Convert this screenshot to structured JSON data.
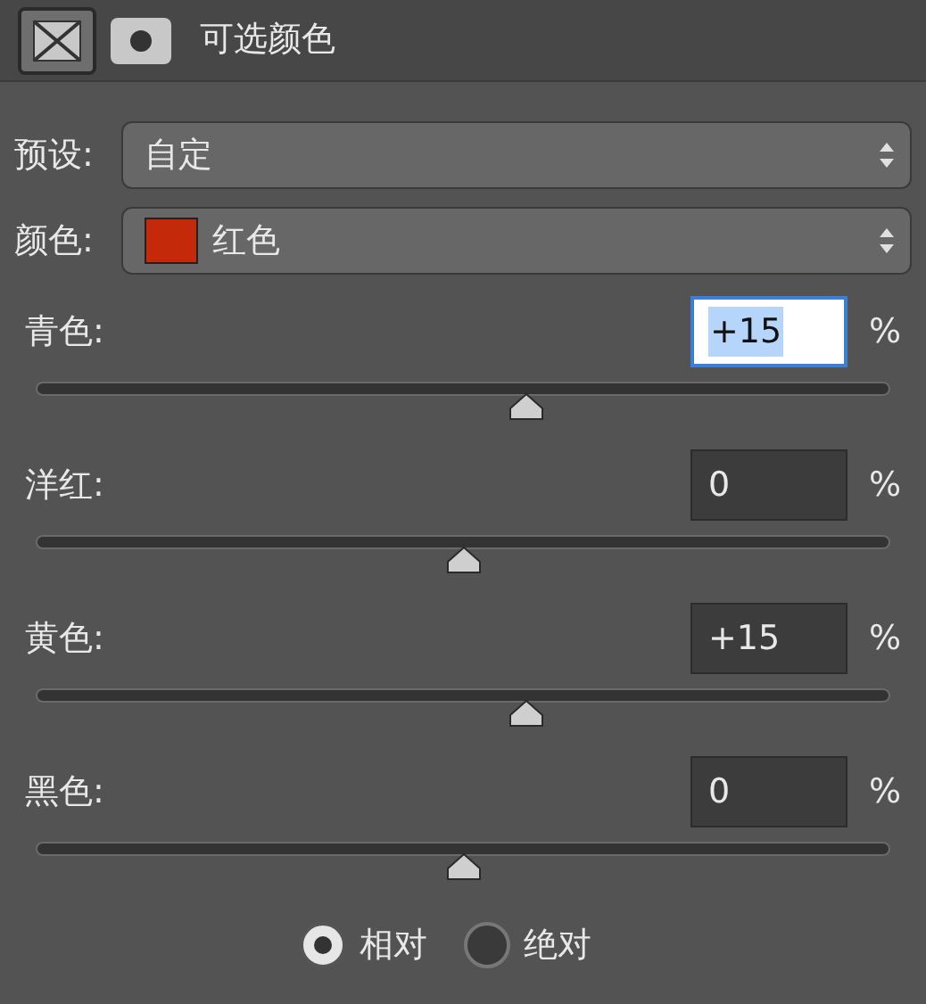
{
  "header": {
    "title": "可选颜色"
  },
  "preset": {
    "label": "预设:",
    "value": "自定"
  },
  "color": {
    "label": "颜色:",
    "value": "红色",
    "color": "#c42a0a"
  },
  "sliders": [
    {
      "label": "青色:",
      "value": "+15",
      "unit": "%",
      "level": 0.575,
      "focused": true
    },
    {
      "label": "洋红:",
      "value": "0",
      "unit": "%",
      "level": 0.5,
      "focused": false
    },
    {
      "label": "黄色:",
      "value": "+15",
      "unit": "%",
      "level": 0.575,
      "focused": false
    },
    {
      "label": "黑色:",
      "value": "0",
      "unit": "%",
      "level": 0.5,
      "focused": false
    }
  ],
  "mode": [
    {
      "label": "相对",
      "selected": true
    },
    {
      "label": "绝对",
      "selected": false
    }
  ]
}
